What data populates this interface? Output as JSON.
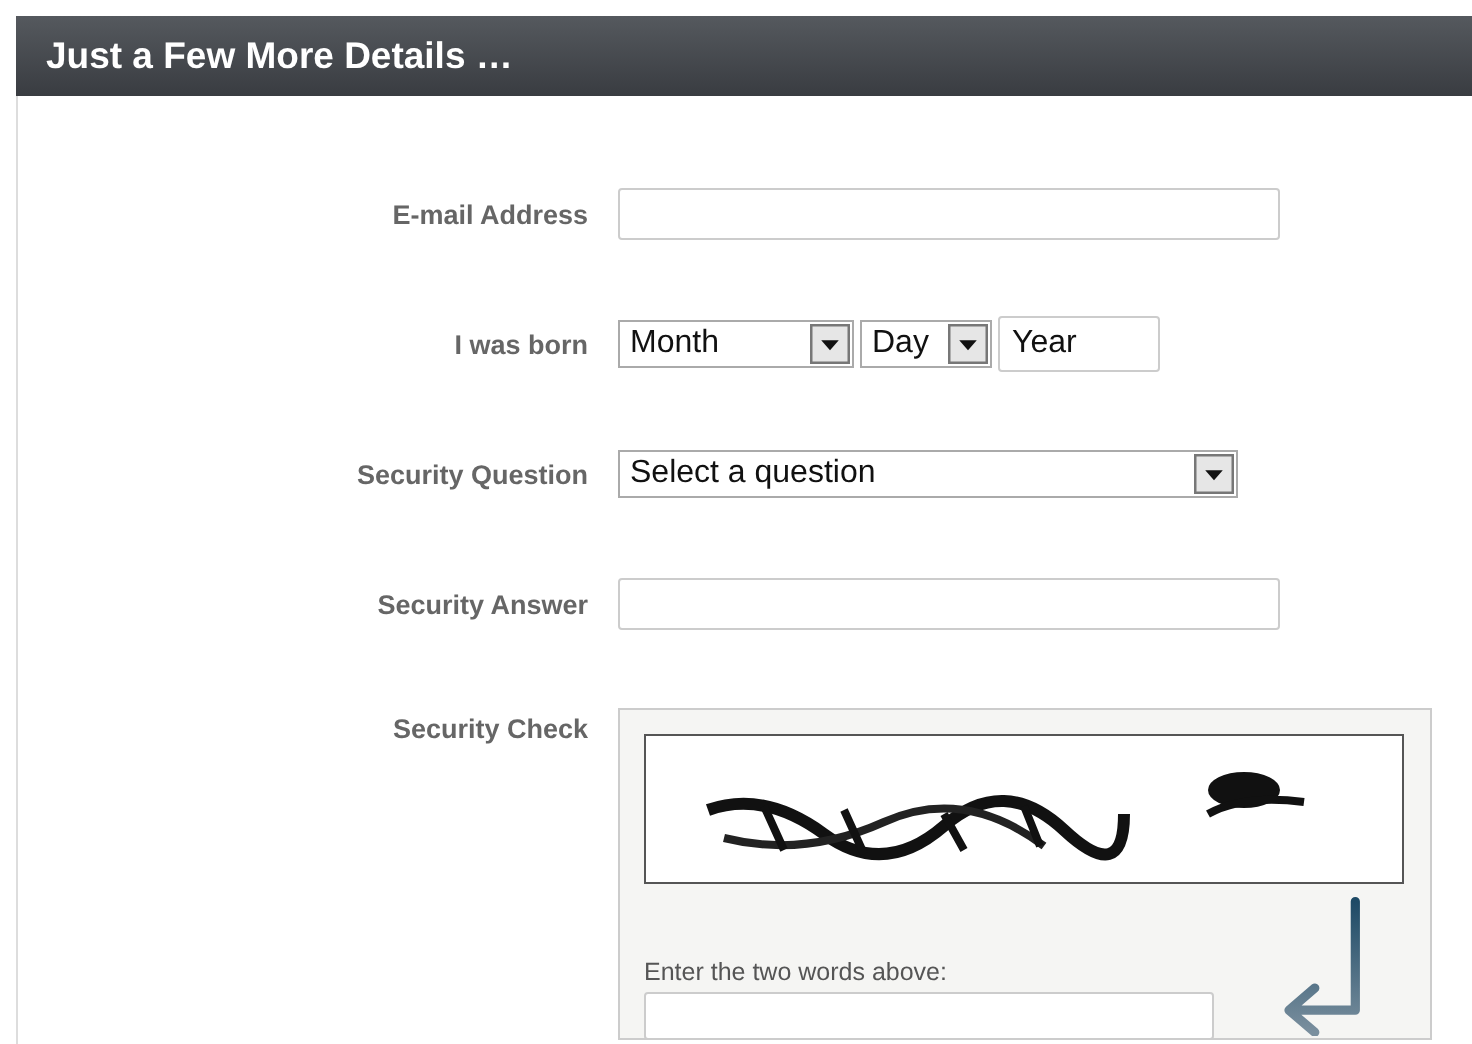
{
  "header": {
    "title": "Just a Few More Details …"
  },
  "fields": [
    {
      "kind": "text",
      "label": "E-mail Address"
    },
    {
      "kind": "date",
      "label": "I was born",
      "parts": [
        {
          "kind": "select",
          "value": "Month"
        },
        {
          "kind": "select",
          "value": "Day"
        },
        {
          "kind": "text",
          "value": "Year"
        }
      ]
    },
    {
      "kind": "select",
      "label": "Security Question",
      "value": "Select a question"
    },
    {
      "kind": "text",
      "label": "Security Answer"
    },
    {
      "kind": "captcha",
      "label": "Security Check",
      "instruction": "Enter the two words above:"
    }
  ]
}
